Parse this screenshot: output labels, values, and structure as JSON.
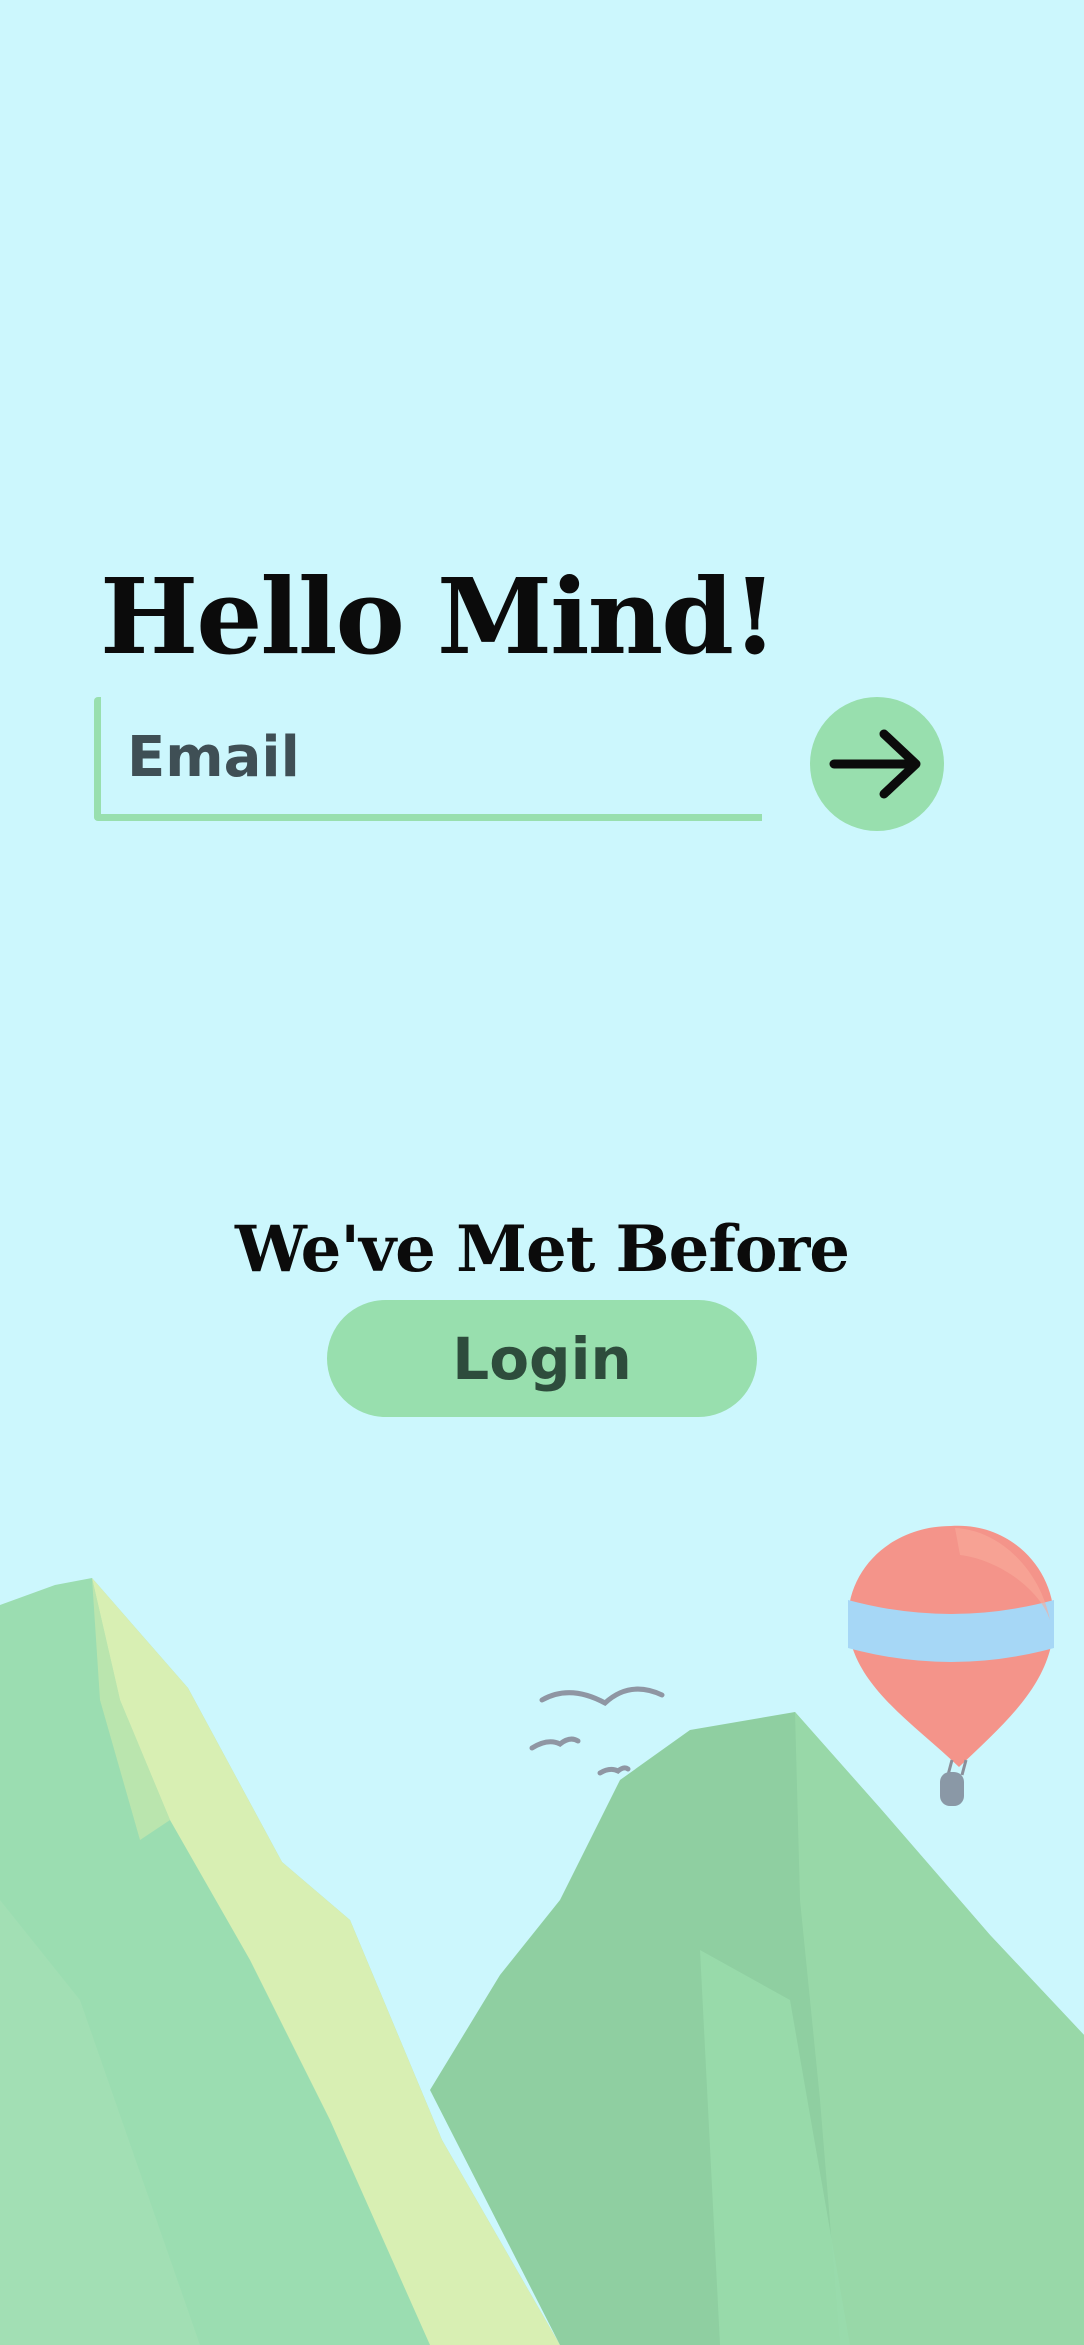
{
  "welcome": {
    "title": "Hello Mind!",
    "email_placeholder": "Email",
    "email_value": "",
    "submit_icon": "arrow-right-icon"
  },
  "returning": {
    "heading": "We've Met Before",
    "login_label": "Login"
  },
  "colors": {
    "background": "#ccf7fd",
    "accent_green": "#98dfae",
    "text_dark": "#0b0b0b",
    "balloon_red": "#f4948a",
    "balloon_band": "#a6d7f6"
  },
  "illustration": {
    "icons": [
      "mountain-left",
      "mountain-right",
      "birds-icon",
      "hot-air-balloon-icon"
    ]
  }
}
